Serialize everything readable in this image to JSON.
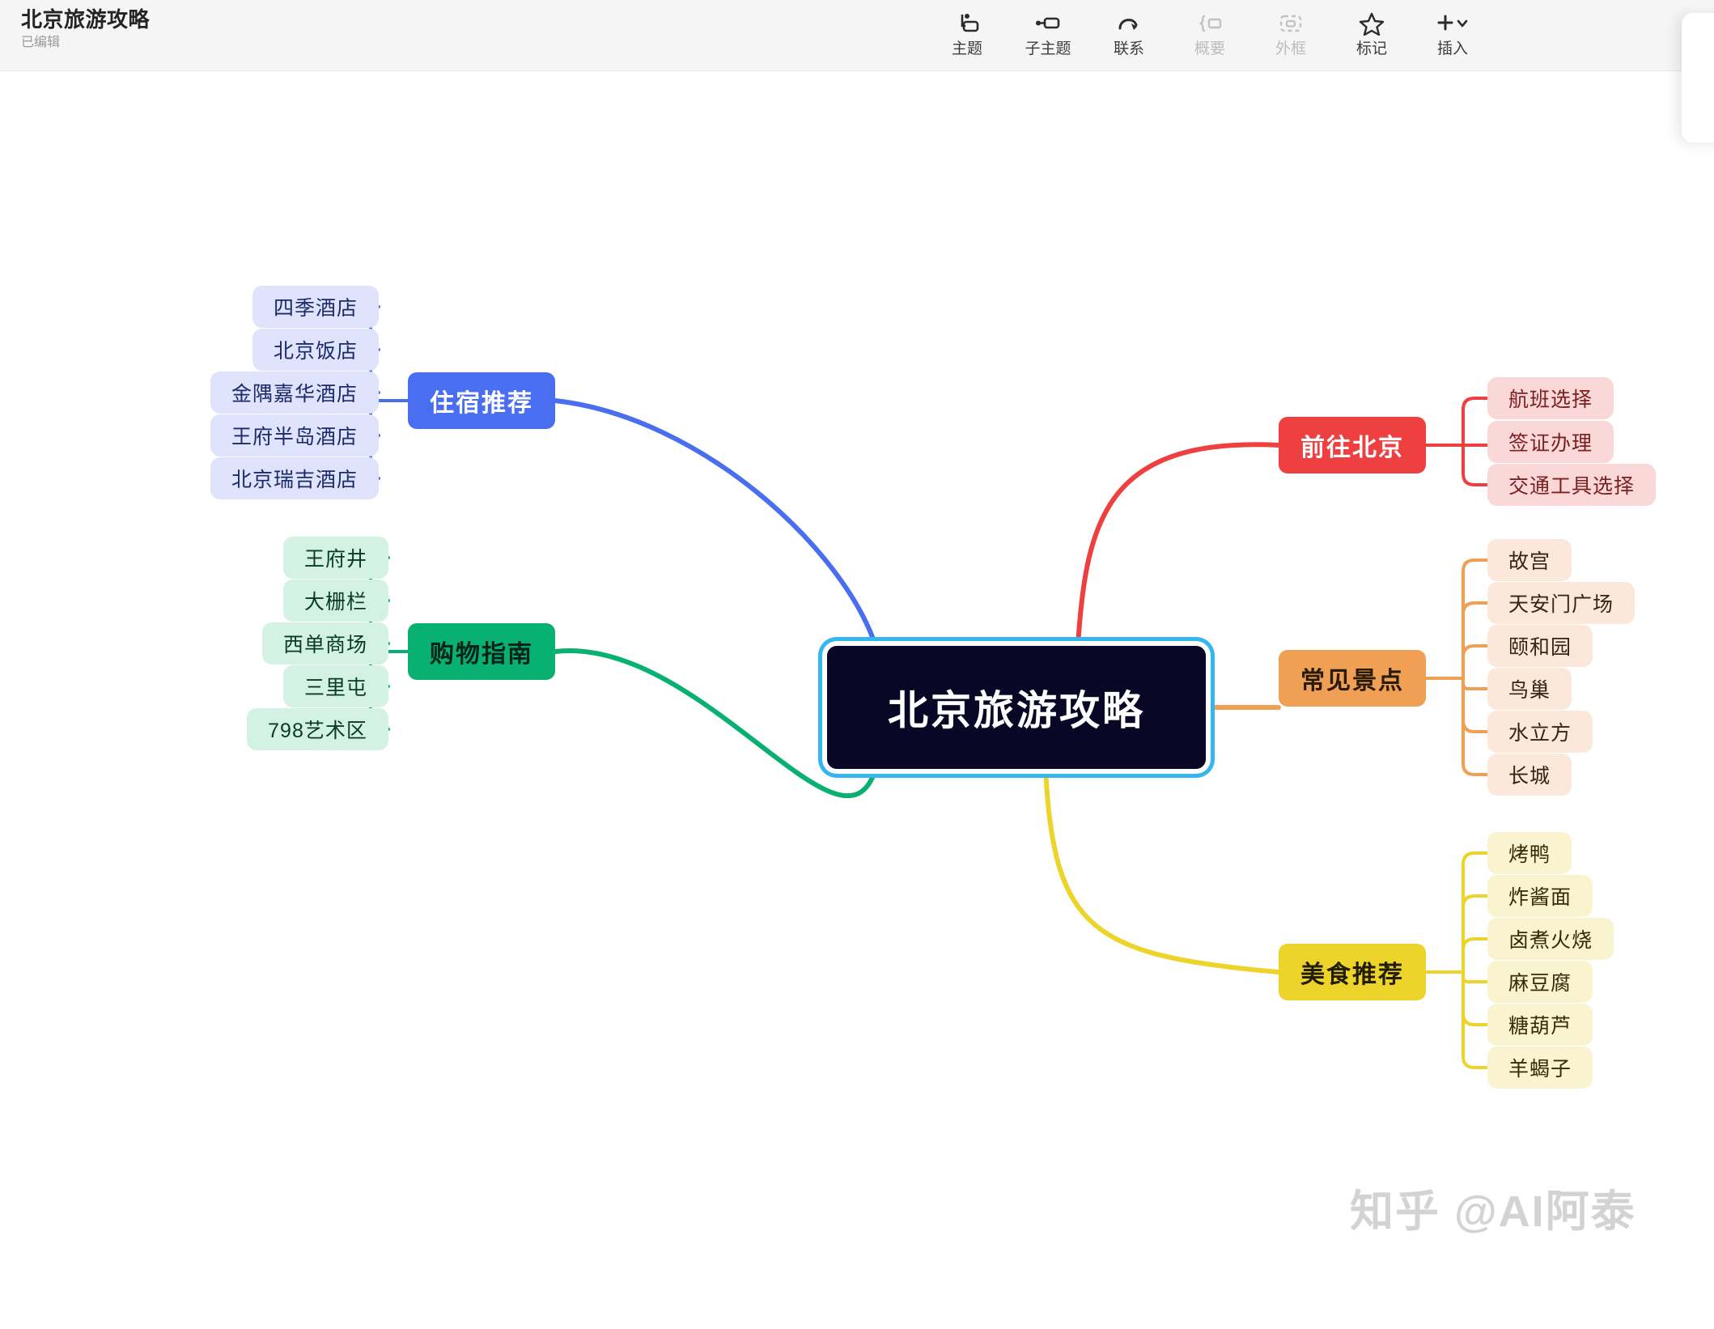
{
  "header": {
    "title": "北京旅游攻略",
    "status": "已编辑",
    "toolbar": [
      {
        "label": "主题",
        "icon": "topic-icon",
        "disabled": false
      },
      {
        "label": "子主题",
        "icon": "subtopic-icon",
        "disabled": false
      },
      {
        "label": "联系",
        "icon": "relation-icon",
        "disabled": false
      },
      {
        "label": "概要",
        "icon": "summary-icon",
        "disabled": true
      },
      {
        "label": "外框",
        "icon": "boundary-icon",
        "disabled": true
      },
      {
        "label": "标记",
        "icon": "star-icon",
        "disabled": false
      },
      {
        "label": "插入",
        "icon": "plus-chevron-icon",
        "disabled": false
      }
    ]
  },
  "mindmap": {
    "root": {
      "label": "北京旅游攻略",
      "fill": "#080826",
      "text_color": "#ffffff",
      "selected": true,
      "selection_color": "#35b6ef"
    },
    "branches": [
      {
        "label": "前往北京",
        "side": "right",
        "color": "#ee4040",
        "text_color": "#ffffff",
        "leaf_fill": "#fbd8d8",
        "leaf_text": "#7a1f1f",
        "children": [
          "航班选择",
          "签证办理",
          "交通工具选择"
        ]
      },
      {
        "label": "常见景点",
        "side": "right",
        "color": "#f0a055",
        "text_color": "#2a1a08",
        "leaf_fill": "#fbe8da",
        "leaf_text": "#3a2410",
        "children": [
          "故宫",
          "天安门广场",
          "颐和园",
          "鸟巢",
          "水立方",
          "长城"
        ]
      },
      {
        "label": "美食推荐",
        "side": "right",
        "color": "#ecd42a",
        "text_color": "#231d02",
        "leaf_fill": "#faf3cf",
        "leaf_text": "#332b06",
        "children": [
          "烤鸭",
          "炸酱面",
          "卤煮火烧",
          "麻豆腐",
          "糖葫芦",
          "羊蝎子"
        ]
      },
      {
        "label": "住宿推荐",
        "side": "left",
        "color": "#4a6ef0",
        "text_color": "#ffffff",
        "leaf_fill": "#dfe3fb",
        "leaf_text": "#1b2a6b",
        "children": [
          "四季酒店",
          "北京饭店",
          "金隅嘉华酒店",
          "王府半岛酒店",
          "北京瑞吉酒店"
        ]
      },
      {
        "label": "购物指南",
        "side": "left",
        "color": "#08b072",
        "text_color": "#04231a",
        "leaf_fill": "#d4f2e3",
        "leaf_text": "#083a2a",
        "children": [
          "王府井",
          "大栅栏",
          "西单商场",
          "三里屯",
          "798艺术区"
        ]
      }
    ]
  },
  "watermark": {
    "text": "知乎 @AI阿泰"
  }
}
